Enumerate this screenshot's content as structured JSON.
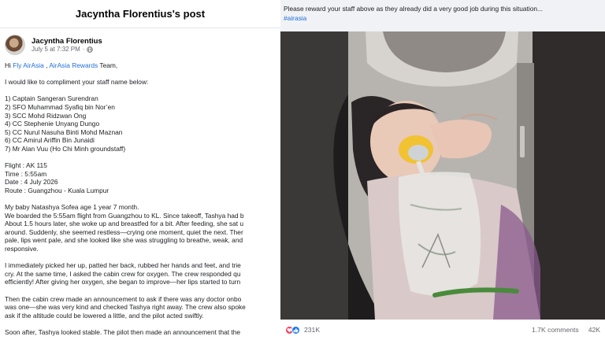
{
  "left_panel": {
    "header_title": "Jacyntha Florentius's post",
    "author": {
      "name": "Jacyntha Florentius",
      "time": "July 5 at 7:32 PM",
      "separator": "·"
    },
    "greeting": {
      "prefix": "Hi ",
      "link1": "Fly AirAsia",
      "sep": " , ",
      "link2": "AirAsia Rewards",
      "suffix": " Team,"
    },
    "lines": {
      "intro": "I would like to compliment your staff name below:",
      "staff": [
        "1) Captain Sangeran Surendran",
        "2) SFO Muhammad Syafiq bin Nor’en",
        "3) SCC Mohd Ridzwan Ong",
        "4) CC Stephenie Unyang Dungo",
        "5) CC Nurul Nasuha Binti Mohd Maznan",
        "6) CC Amirul Ariffin Bin Junaidi",
        "7) Mr Alan Vuu (Ho Chi Minh groundstaff)"
      ],
      "flight_info": [
        "Flight : AK 115",
        "Time : 5:55am",
        "Date : 4 July 2026",
        "Route : Guangzhou - Kuala Lumpur"
      ],
      "para1": [
        "My baby Natashya Sofea age 1 year 7 month.",
        "We boarded the 5:55am flight from Guangzhou to KL. Since takeoff, Tashya had b",
        "About 1.5 hours later, she woke up and breastfed for a bit. After feeding, she sat u",
        "around. Suddenly, she seemed restless—crying one moment, quiet the next. Ther",
        "pale, lips went pale, and she looked like she was struggling to breathe, weak, and",
        "responsive."
      ],
      "para2": [
        "I immediately picked her up, patted her back, rubbed her hands and feet, and trie",
        "cry. At the same time, I asked the cabin crew for oxygen. The crew responded qu",
        "efficiently! After giving her oxygen, she began to improve—her lips started to turn"
      ],
      "para3": [
        "Then the cabin crew made an announcement to ask if there was any doctor onbo",
        "was one—she was very kind and checked Tashya right away. The crew also spoke",
        "ask if the altitude could be lowered a little, and the pilot acted swiftly."
      ],
      "para4": [
        "Soon after, Tashya looked stable. The pilot then made an announcement that the"
      ]
    }
  },
  "right_panel": {
    "caption": "Please reward your staff above as they already did a very good job during this situation...",
    "hashtag": "#airasia",
    "reactions": {
      "count": "231K",
      "comments": "1.7K comments",
      "shares": "42K"
    },
    "colors": {
      "love": "#f33e58",
      "like": "#1877f2",
      "link": "#216fdb"
    },
    "icons": [
      "love-reaction-icon",
      "like-reaction-icon",
      "globe-icon"
    ]
  }
}
